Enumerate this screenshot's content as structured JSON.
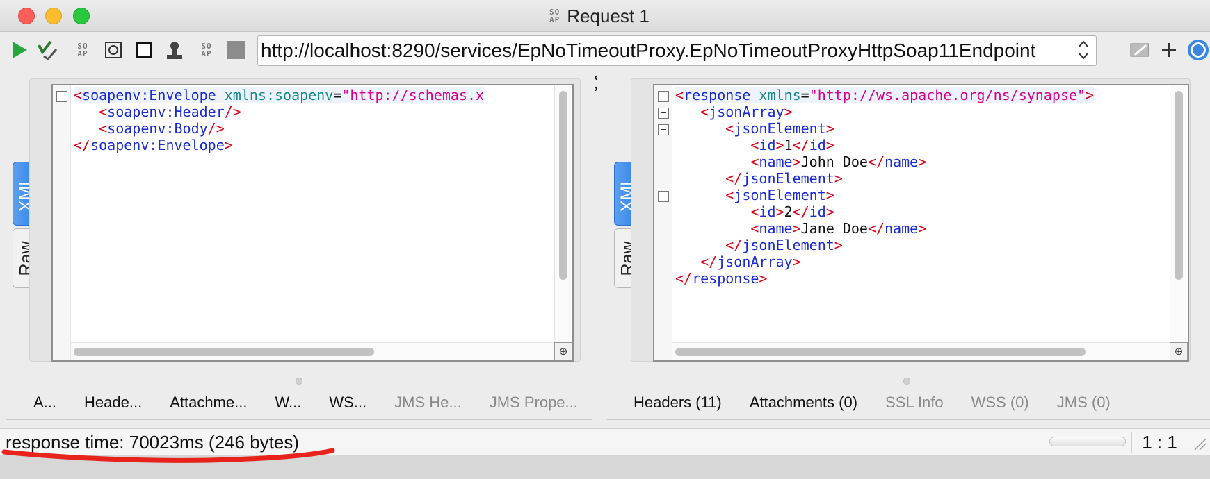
{
  "window": {
    "title": "Request 1",
    "logo_text": "SOAP"
  },
  "toolbar": {
    "url": "http://localhost:8290/services/EpNoTimeoutProxy.EpNoTimeoutProxyHttpSoap11Endpoint",
    "buttons": [
      "submit-request",
      "add-assertion",
      "create-soap-template",
      "wsdl-update",
      "stop",
      "add-user",
      "soap-action",
      "cancel"
    ]
  },
  "request_pane": {
    "tabs": {
      "xml": "XML",
      "raw": "Raw"
    },
    "lines": [
      [
        [
          "p",
          "<"
        ],
        [
          "t",
          "soapenv:Envelope "
        ],
        [
          "a",
          "xmlns:soapenv"
        ],
        [
          "x",
          "="
        ],
        [
          "v",
          "\"http://schemas.x"
        ]
      ],
      [
        [
          "x",
          "   "
        ],
        [
          "p",
          "<"
        ],
        [
          "t",
          "soapenv:Header"
        ],
        [
          "p",
          "/>"
        ]
      ],
      [
        [
          "x",
          "   "
        ],
        [
          "p",
          "<"
        ],
        [
          "t",
          "soapenv:Body"
        ],
        [
          "p",
          "/>"
        ]
      ],
      [
        [
          "p",
          "</"
        ],
        [
          "t",
          "soapenv:Envelope"
        ],
        [
          "p",
          ">"
        ]
      ]
    ]
  },
  "response_pane": {
    "tabs": {
      "xml": "XML",
      "raw": "Raw"
    },
    "lines": [
      [
        [
          "p",
          "<"
        ],
        [
          "t",
          "response "
        ],
        [
          "a",
          "xmlns"
        ],
        [
          "x",
          "="
        ],
        [
          "v",
          "\"http://ws.apache.org/ns/synapse\""
        ],
        [
          "p",
          ">"
        ]
      ],
      [
        [
          "x",
          "   "
        ],
        [
          "p",
          "<"
        ],
        [
          "t",
          "jsonArray"
        ],
        [
          "p",
          ">"
        ]
      ],
      [
        [
          "x",
          "      "
        ],
        [
          "p",
          "<"
        ],
        [
          "t",
          "jsonElement"
        ],
        [
          "p",
          ">"
        ]
      ],
      [
        [
          "x",
          "         "
        ],
        [
          "p",
          "<"
        ],
        [
          "t",
          "id"
        ],
        [
          "p",
          ">"
        ],
        [
          "x",
          "1"
        ],
        [
          "p",
          "</"
        ],
        [
          "t",
          "id"
        ],
        [
          "p",
          ">"
        ]
      ],
      [
        [
          "x",
          "         "
        ],
        [
          "p",
          "<"
        ],
        [
          "t",
          "name"
        ],
        [
          "p",
          ">"
        ],
        [
          "x",
          "John Doe"
        ],
        [
          "p",
          "</"
        ],
        [
          "t",
          "name"
        ],
        [
          "p",
          ">"
        ]
      ],
      [
        [
          "x",
          "      "
        ],
        [
          "p",
          "</"
        ],
        [
          "t",
          "jsonElement"
        ],
        [
          "p",
          ">"
        ]
      ],
      [
        [
          "x",
          "      "
        ],
        [
          "p",
          "<"
        ],
        [
          "t",
          "jsonElement"
        ],
        [
          "p",
          ">"
        ]
      ],
      [
        [
          "x",
          "         "
        ],
        [
          "p",
          "<"
        ],
        [
          "t",
          "id"
        ],
        [
          "p",
          ">"
        ],
        [
          "x",
          "2"
        ],
        [
          "p",
          "</"
        ],
        [
          "t",
          "id"
        ],
        [
          "p",
          ">"
        ]
      ],
      [
        [
          "x",
          "         "
        ],
        [
          "p",
          "<"
        ],
        [
          "t",
          "name"
        ],
        [
          "p",
          ">"
        ],
        [
          "x",
          "Jane Doe"
        ],
        [
          "p",
          "</"
        ],
        [
          "t",
          "name"
        ],
        [
          "p",
          ">"
        ]
      ],
      [
        [
          "x",
          "      "
        ],
        [
          "p",
          "</"
        ],
        [
          "t",
          "jsonElement"
        ],
        [
          "p",
          ">"
        ]
      ],
      [
        [
          "x",
          "   "
        ],
        [
          "p",
          "</"
        ],
        [
          "t",
          "jsonArray"
        ],
        [
          "p",
          ">"
        ]
      ],
      [
        [
          "p",
          "</"
        ],
        [
          "t",
          "response"
        ],
        [
          "p",
          ">"
        ]
      ]
    ]
  },
  "request_bottom_tabs": [
    {
      "label": "A...",
      "enabled": true
    },
    {
      "label": "Heade...",
      "enabled": true
    },
    {
      "label": "Attachme...",
      "enabled": true
    },
    {
      "label": "W...",
      "enabled": true
    },
    {
      "label": "WS...",
      "enabled": true
    },
    {
      "label": "JMS He...",
      "enabled": false
    },
    {
      "label": "JMS Prope...",
      "enabled": false
    }
  ],
  "response_bottom_tabs": [
    {
      "label": "Headers (11)",
      "enabled": true
    },
    {
      "label": "Attachments (0)",
      "enabled": true
    },
    {
      "label": "SSL Info",
      "enabled": false
    },
    {
      "label": "WSS (0)",
      "enabled": false
    },
    {
      "label": "JMS (0)",
      "enabled": false
    }
  ],
  "status": {
    "response_text": "response time: 70023ms (246 bytes)",
    "cursor_position": "1 : 1",
    "annotation_color": "#e8231c"
  }
}
